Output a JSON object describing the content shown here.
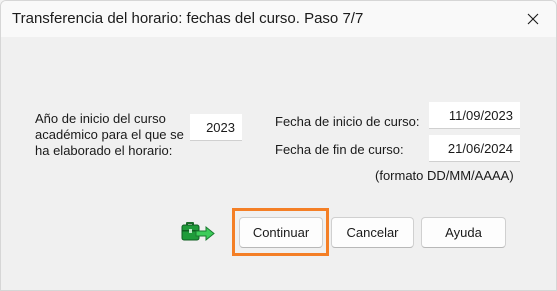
{
  "window": {
    "title": "Transferencia del horario: fechas del curso. Paso 7/7",
    "close_icon": "close-icon"
  },
  "form": {
    "year_label_lines": [
      "Año de inicio del curso",
      "académico para el que se",
      "ha elaborado el horario:"
    ],
    "year_value": "2023",
    "start_date_label": "Fecha de inicio de curso:",
    "start_date_value": "11/09/2023",
    "end_date_label": "Fecha de fin de curso:",
    "end_date_value": "21/06/2024",
    "format_hint": "(formato DD/MM/AAAA)"
  },
  "buttons": {
    "continue_label": "Continuar",
    "cancel_label": "Cancelar",
    "help_label": "Ayuda"
  },
  "icons": {
    "app_icon": "green-briefcase-arrow-icon"
  },
  "colors": {
    "focus_highlight": "#f47f26",
    "icon_green": "#1f9b3a"
  }
}
